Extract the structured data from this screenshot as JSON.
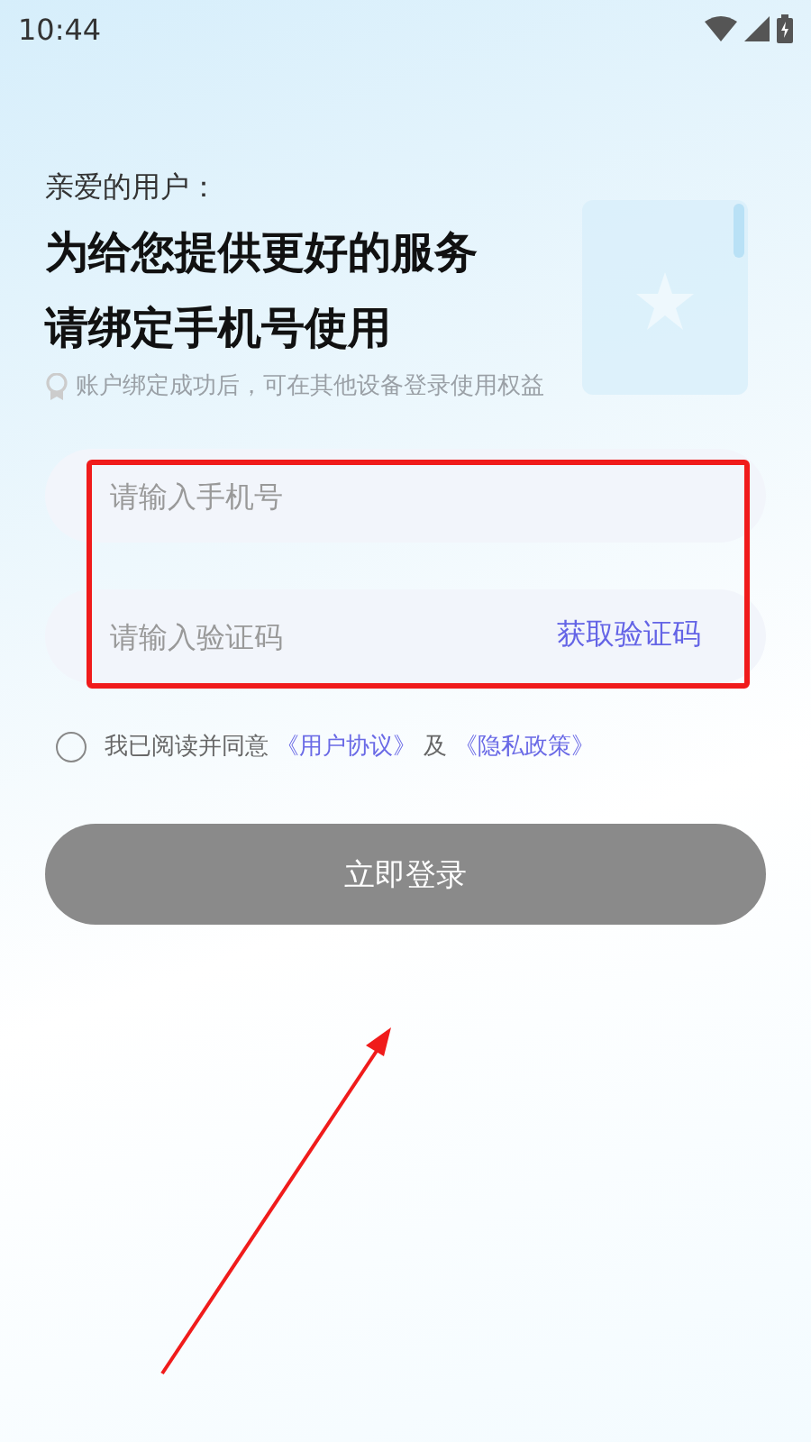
{
  "status_bar": {
    "time": "10:44"
  },
  "greeting": "亲爱的用户：",
  "headline": [
    "为给您提供更好的服务",
    "请绑定手机号使用"
  ],
  "hint": "账户绑定成功后，可在其他设备登录使用权益",
  "fields": [
    {
      "placeholder": "请输入手机号"
    },
    {
      "placeholder": "请输入验证码",
      "action": "获取验证码"
    }
  ],
  "agreement": {
    "checked": false,
    "parts": [
      {
        "kind": "text",
        "text": "我已阅读并同意"
      },
      {
        "kind": "link",
        "text": "《用户协议》"
      },
      {
        "kind": "text",
        "text": "及"
      },
      {
        "kind": "link",
        "text": "《隐私政策》"
      }
    ]
  },
  "login_button": {
    "label": "立即登录",
    "disabled": true
  }
}
